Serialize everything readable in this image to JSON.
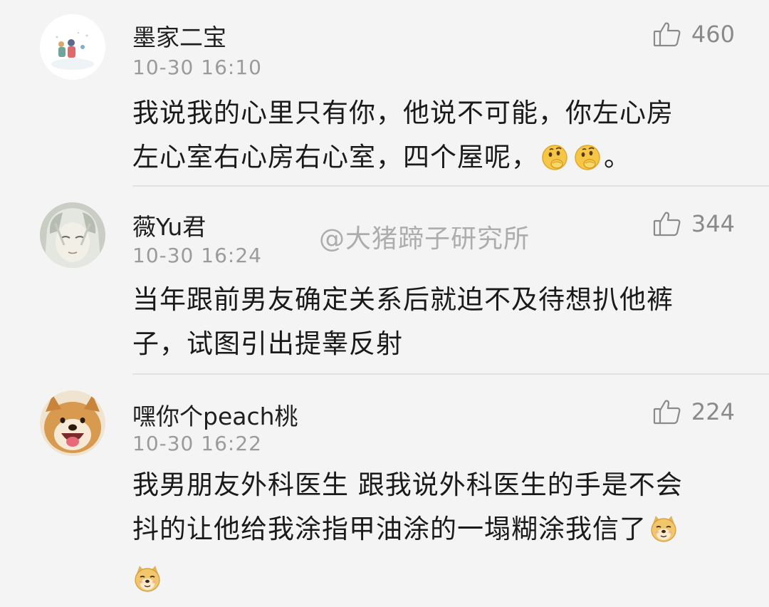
{
  "watermark": "@大猪蹄子研究所",
  "comments": [
    {
      "username": "墨家二宝",
      "time": "10-30 16:10",
      "likes": "460",
      "line1": "我说我的心里只有你，他说不可能，你左心房",
      "line2": "左心室右心房右心室，四个屋呢，",
      "line2_end": "。",
      "emojis": [
        "thinking-face-emoji",
        "thinking-face-emoji"
      ]
    },
    {
      "username": "薇Yu君",
      "time": "10-30 16:24",
      "likes": "344",
      "line1": "当年跟前男友确定关系后就迫不及待想扒他裤",
      "line2": "子，试图引出提睾反射"
    },
    {
      "username": "嘿你个peach桃",
      "time": "10-30 16:22",
      "likes": "224",
      "line1": "我男朋友外科医生 跟我说外科医生的手是不会",
      "line2": "抖的让他给我涂指甲油涂的一塌糊涂我信了",
      "emojis": [
        "doge-emoji",
        "doge-emoji"
      ]
    }
  ],
  "icons": {
    "like": "thumbs-up-icon"
  },
  "colors": {
    "background": "#f4f4f4",
    "username": "#1f1f1f",
    "timestamp": "#9b9b9b",
    "like": "#8a8a8a",
    "divider": "#e2e2e2"
  }
}
